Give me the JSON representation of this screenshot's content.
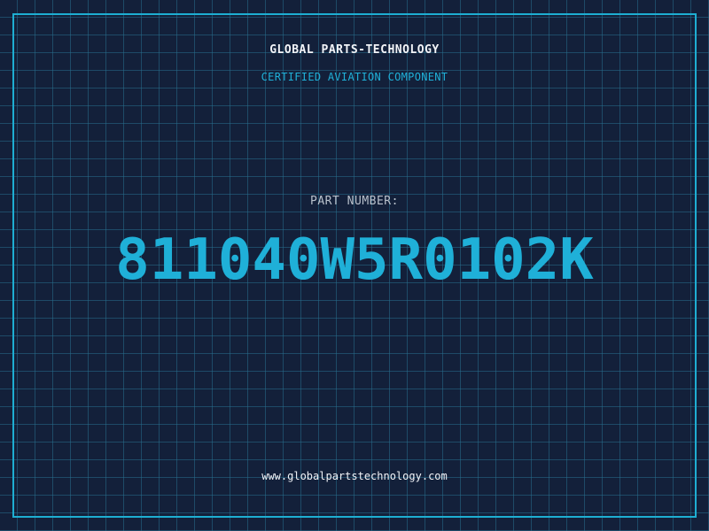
{
  "company": "GLOBAL PARTS-TECHNOLOGY",
  "subtitle": "CERTIFIED AVIATION COMPONENT",
  "part_label": "PART NUMBER:",
  "part_number": "811040W5R0102K",
  "website": "www.globalpartstechnology.com",
  "colors": {
    "background": "#13203a",
    "grid": "#276e8c",
    "accent": "#1fb0d8",
    "text": "#f2f4f8",
    "muted_text": "#b9c1cc"
  }
}
